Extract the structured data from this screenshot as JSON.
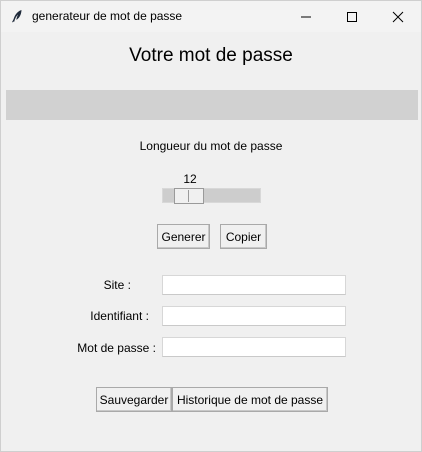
{
  "window": {
    "title": "generateur de mot de passe",
    "icon": "feather-icon",
    "controls": [
      "minimize-icon",
      "maximize-icon",
      "close-icon"
    ]
  },
  "main": {
    "heading": "Votre mot de passe",
    "password_display": "",
    "length": {
      "label": "Longueur du mot de passe",
      "value": "12"
    },
    "buttons": {
      "generate": "Generer",
      "copy": "Copier"
    },
    "form": {
      "site_label": "Site :",
      "site_value": "",
      "id_label": "Identifiant :",
      "id_value": "",
      "password_label": "Mot de passe :",
      "password_value": ""
    },
    "footer": {
      "save": "Sauvegarder",
      "history": "Historique de mot de passe"
    }
  },
  "colors": {
    "background": "#f0f0f0",
    "display_bar": "#d1d1d1",
    "trough": "#cdcdcd",
    "field": "#ffffff"
  }
}
